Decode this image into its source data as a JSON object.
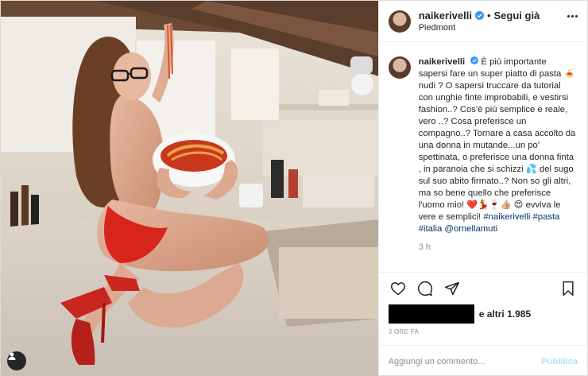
{
  "post": {
    "username": "naikerivelli",
    "follow_state": "Segui già",
    "location": "Piedmont",
    "caption_user": "naikerivelli",
    "caption": "È più importante sapersi fare un super piatto di pasta 🍝 nudi ? O sapersi truccare da tutorial con unghie finte improbabili, e vestirsi fashion..? Cos'è più semplice e reale, vero ..? Cosa preferisce un compagno..? Tornare a casa accolto da una donna in mutande...un po' spettinata, o preferisce una donna finta , in paranoia che si schizzi 💦 del sugo sul suo abito firmato..? Non so gli altri, ma so bene quello che preferisce l'uomo mio! ❤️💃🍷👍🏼 😍 evviva le vere e semplici! ",
    "hashtags": [
      "#naikerivelli",
      "#pasta",
      "#italia",
      "@ornellamuti"
    ],
    "caption_age": "3 h",
    "likes_text": "e altri 1.985",
    "timestamp": "3 ORE FA",
    "comment_placeholder": "Aggiungi un commento...",
    "publish_label": "Pubblica"
  },
  "icons": {
    "verified": "verified-badge-icon",
    "more": "more-options-icon",
    "like": "heart-icon",
    "comment": "comment-icon",
    "share": "paper-plane-icon",
    "save": "bookmark-icon",
    "user_tag": "user-tag-icon"
  },
  "colors": {
    "verified": "#3897f0",
    "link": "#00376b",
    "muted": "#8e8e8e",
    "publish_disabled": "#b2dffc"
  }
}
